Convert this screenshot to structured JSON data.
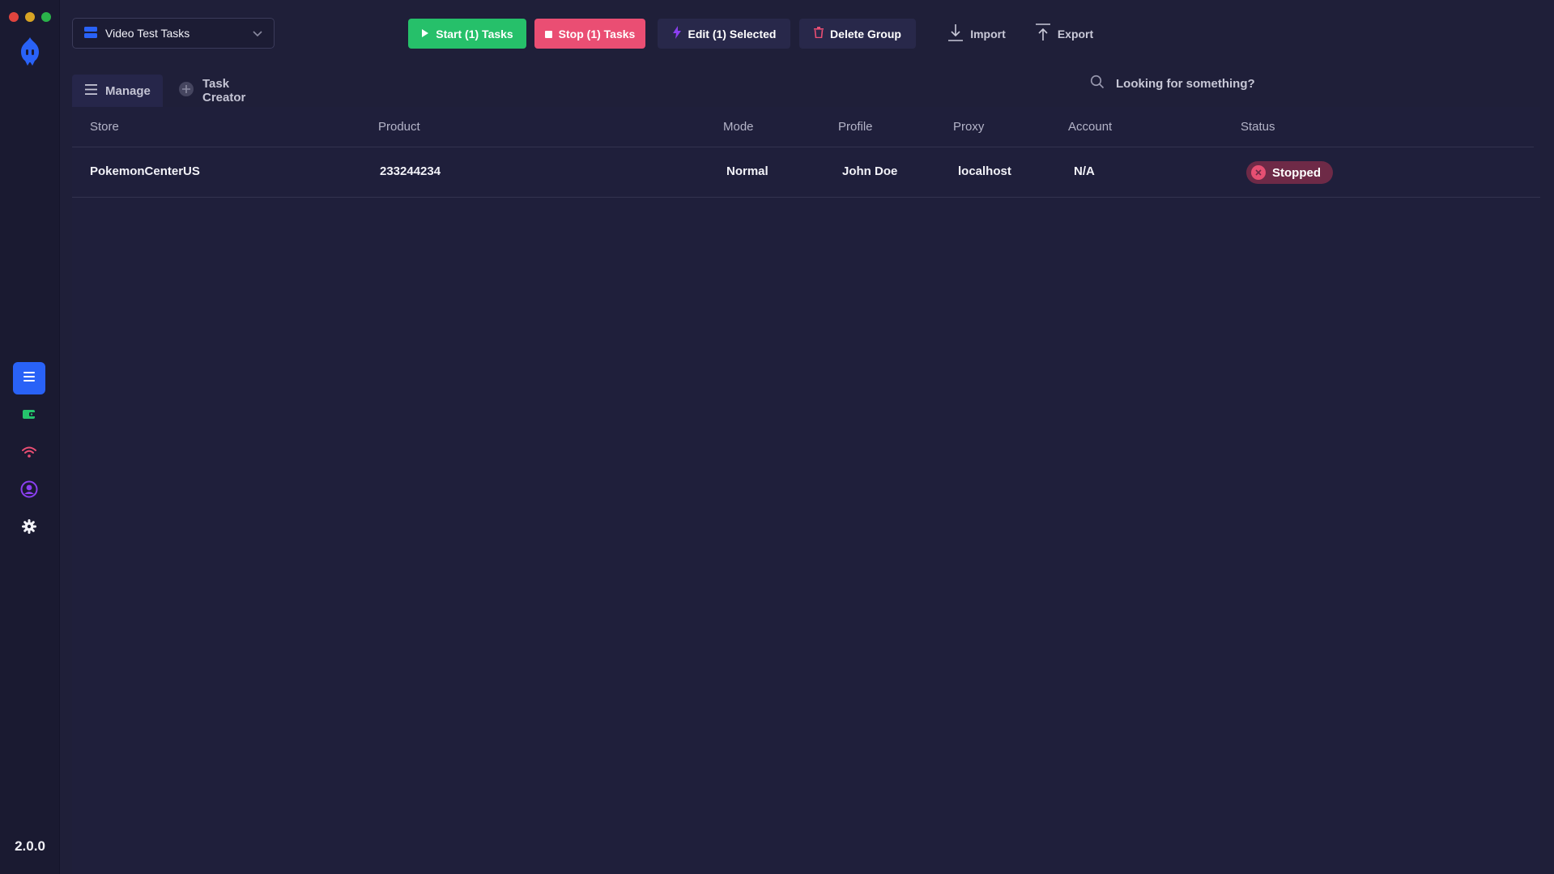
{
  "sidebar": {
    "version": "2.0.0",
    "nav": [
      {
        "icon": "list-icon",
        "active": true
      },
      {
        "icon": "wallet-icon",
        "active": false
      },
      {
        "icon": "wifi-icon",
        "active": false
      },
      {
        "icon": "user-circle-icon",
        "active": false
      },
      {
        "icon": "gear-icon",
        "active": false
      }
    ]
  },
  "toolbar": {
    "group_name": "Video Test Tasks",
    "start_label": "Start (1) Tasks",
    "stop_label": "Stop (1) Tasks",
    "edit_label": "Edit (1) Selected",
    "delete_label": "Delete Group",
    "import_label": "Import",
    "export_label": "Export"
  },
  "tabs": {
    "manage": "Manage",
    "creator": "Task Creator"
  },
  "search": {
    "placeholder": "Looking for something?"
  },
  "table": {
    "columns": [
      "Store",
      "Product",
      "Mode",
      "Profile",
      "Proxy",
      "Account",
      "Status"
    ],
    "rows": [
      {
        "store": "PokemonCenterUS",
        "product": "233244234",
        "mode": "Normal",
        "profile": "John Doe",
        "proxy": "localhost",
        "account": "N/A",
        "status": "Stopped"
      }
    ]
  },
  "colors": {
    "background": "#1f1f39",
    "sidebar": "#1a1a31",
    "accent_blue": "#2962f7",
    "start_green": "#26c06a",
    "stop_red": "#ea4e73",
    "status_stopped_bg": "#6e2a47"
  }
}
